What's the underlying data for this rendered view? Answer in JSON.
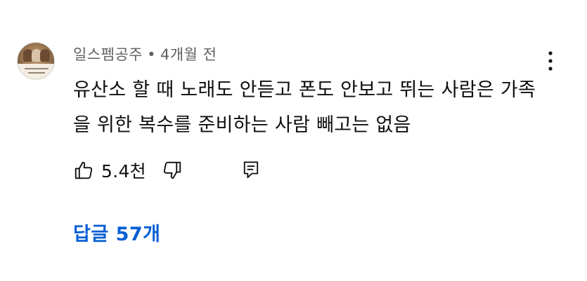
{
  "comment": {
    "author": "일스펨공주",
    "separator": "•",
    "time": "4개월 전",
    "text": "유산소 할 때 노래도 안듣고 폰도 안보고 뛰는 사람은 가족을 위한 복수를 준비하는 사람 빼고는 없음",
    "like_count": "5.4천",
    "replies_label": "답글 57개",
    "avatar_text": "",
    "icons": {
      "more": "more-vert-icon",
      "like": "thumbs-up-icon",
      "dislike": "thumbs-down-icon",
      "reply": "reply-comment-icon"
    }
  },
  "colors": {
    "text": "#0f0f0f",
    "meta": "#606060",
    "link": "#065fd4",
    "background": "#ffffff"
  }
}
